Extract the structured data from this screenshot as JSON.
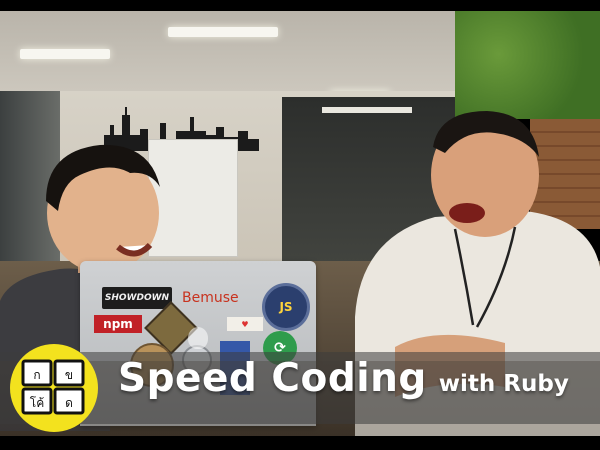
{
  "banner": {
    "title": "Speed Coding",
    "subtitle": "with Ruby"
  },
  "laptop_stickers": {
    "showdown": "SHOWDOWN",
    "bemuse": "Bemuse",
    "js": "JS",
    "npm": "npm"
  },
  "logo": {
    "keys": [
      "ก",
      "ข",
      "โค้",
      "ด"
    ]
  },
  "colors": {
    "logo_yellow": "#f3e21e",
    "banner_bar": "#3c3c3c",
    "green_wall": "#4f8a2c",
    "npm_red": "#c12127",
    "bemuse_red": "#c8321e"
  }
}
